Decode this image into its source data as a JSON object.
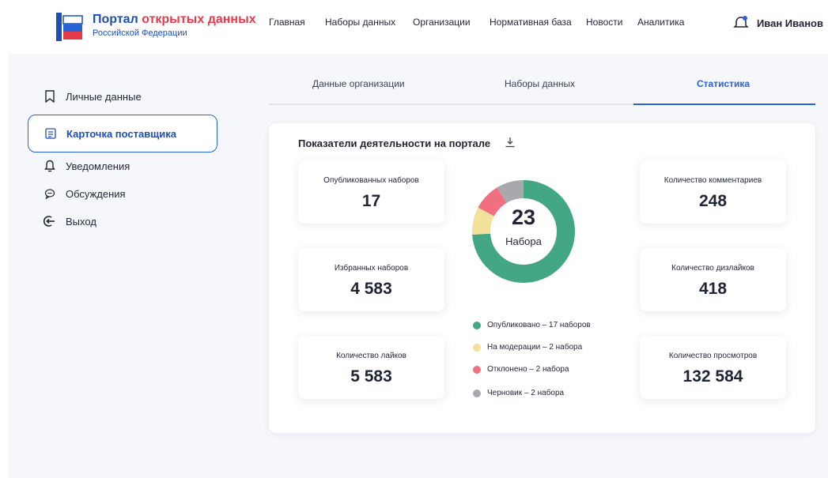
{
  "header": {
    "logo_title_part1": "Портал",
    "logo_title_part2": "открытых данных",
    "logo_subtitle": "Российской Федерации",
    "nav": [
      "Главная",
      "Наборы данных",
      "Организации",
      "Нормативная база",
      "Новости",
      "Аналитика"
    ],
    "user_name": "Иван Иванов",
    "logo_icon": "book-flag-icon",
    "notify_icon": "bell-icon"
  },
  "sidebar": {
    "items": [
      {
        "label": "Личные данные",
        "icon": "bookmark-icon"
      },
      {
        "label": "Карточка поставщика",
        "icon": "card-icon"
      },
      {
        "label": "Уведомления",
        "icon": "bell-icon"
      },
      {
        "label": "Обсуждения",
        "icon": "chat-icon"
      },
      {
        "label": "Выход",
        "icon": "logout-icon"
      }
    ]
  },
  "tabs": [
    "Данные организации",
    "Наборы данных",
    "Статистика"
  ],
  "panel": {
    "title": "Показатели деятельности на портале",
    "download_icon": "download-icon",
    "cards_left": [
      {
        "label": "Опубликованных наборов",
        "value": "17"
      },
      {
        "label": "Избранных наборов",
        "value": "4 583"
      },
      {
        "label": "Количество лайков",
        "value": "5 583"
      }
    ],
    "cards_right": [
      {
        "label": "Количество комментариев",
        "value": "248"
      },
      {
        "label": "Количество дизлайков",
        "value": "418"
      },
      {
        "label": "Количество просмотров",
        "value": "132 584"
      }
    ],
    "donut_total": "23",
    "donut_sub": "Набора",
    "legend": [
      "Опубликовано – 17 наборов",
      "На модерации – 2 набора",
      "Отклонено – 2 набора",
      "Черновик – 2 набора"
    ]
  },
  "colors": {
    "primary": "#2a63d6",
    "accent_red": "#e53a4a",
    "published": "#43a784",
    "moderation": "#f1e19a",
    "rejected": "#f26f80",
    "draft": "#a7a9ae"
  },
  "chart_data": {
    "type": "pie",
    "categories": [
      "Опубликовано",
      "На модерации",
      "Отклонено",
      "Черновик"
    ],
    "values": [
      17,
      2,
      2,
      2
    ],
    "title": "",
    "colors": [
      "#43a784",
      "#f1e19a",
      "#f26f80",
      "#a7a9ae"
    ]
  }
}
